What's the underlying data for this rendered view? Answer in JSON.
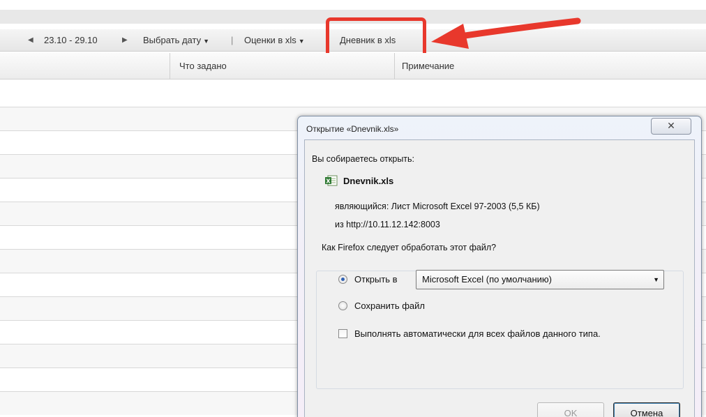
{
  "toolbar": {
    "prev_arrow": "◀",
    "date_range": "23.10 - 29.10",
    "next_arrow": "▶",
    "choose_date": "Выбрать дату",
    "separator": "|",
    "grades_xls": "Оценки в xls",
    "diary_xls": "Дневник в xls"
  },
  "columns": {
    "assigned": "Что задано",
    "note": "Примечание"
  },
  "dialog": {
    "title": "Открытие «Dnevnik.xls»",
    "close_glyph": "✕",
    "intro": "Вы собираетесь открыть:",
    "file_name": "Dnevnik.xls",
    "type_line": "являющийся:  Лист Microsoft Excel 97-2003 (5,5 КБ)",
    "source_line": "из  http://10.11.12.142:8003",
    "question": "Как Firefox следует обработать этот файл?",
    "open_with_label": "Открыть в",
    "open_with_value": "Microsoft Excel (по умолчанию)",
    "save_label": "Сохранить файл",
    "auto_label": "Выполнять автоматически для всех файлов данного типа.",
    "ok_button": "OK",
    "cancel_button": "Отмена"
  },
  "colors": {
    "highlight": "#e8382c",
    "arrow": "#e8382c"
  }
}
